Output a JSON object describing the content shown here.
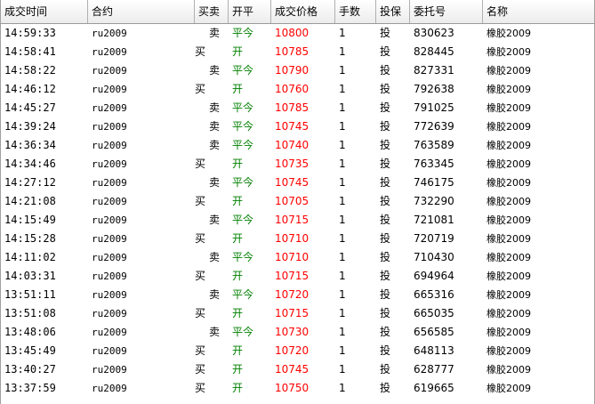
{
  "columns": [
    "成交时间",
    "合约",
    "买卖",
    "开平",
    "成交价格",
    "手数",
    "投保",
    "委托号",
    "名称"
  ],
  "colors": {
    "open_close": "#008000",
    "price": "#ff0000"
  },
  "rows": [
    {
      "time": "14:59:33",
      "contract": "ru2009",
      "side": "卖",
      "oc": "平今",
      "price": "10800",
      "qty": "1",
      "hedge": "投",
      "order": "830623",
      "name": "橡胶2009"
    },
    {
      "time": "14:58:41",
      "contract": "ru2009",
      "side": "买",
      "oc": "开",
      "price": "10785",
      "qty": "1",
      "hedge": "投",
      "order": "828445",
      "name": "橡胶2009"
    },
    {
      "time": "14:58:22",
      "contract": "ru2009",
      "side": "卖",
      "oc": "平今",
      "price": "10790",
      "qty": "1",
      "hedge": "投",
      "order": "827331",
      "name": "橡胶2009"
    },
    {
      "time": "14:46:12",
      "contract": "ru2009",
      "side": "买",
      "oc": "开",
      "price": "10760",
      "qty": "1",
      "hedge": "投",
      "order": "792638",
      "name": "橡胶2009"
    },
    {
      "time": "14:45:27",
      "contract": "ru2009",
      "side": "卖",
      "oc": "平今",
      "price": "10785",
      "qty": "1",
      "hedge": "投",
      "order": "791025",
      "name": "橡胶2009"
    },
    {
      "time": "14:39:24",
      "contract": "ru2009",
      "side": "卖",
      "oc": "平今",
      "price": "10745",
      "qty": "1",
      "hedge": "投",
      "order": "772639",
      "name": "橡胶2009"
    },
    {
      "time": "14:36:34",
      "contract": "ru2009",
      "side": "卖",
      "oc": "平今",
      "price": "10740",
      "qty": "1",
      "hedge": "投",
      "order": "763589",
      "name": "橡胶2009"
    },
    {
      "time": "14:34:46",
      "contract": "ru2009",
      "side": "买",
      "oc": "开",
      "price": "10735",
      "qty": "1",
      "hedge": "投",
      "order": "763345",
      "name": "橡胶2009"
    },
    {
      "time": "14:27:12",
      "contract": "ru2009",
      "side": "卖",
      "oc": "平今",
      "price": "10745",
      "qty": "1",
      "hedge": "投",
      "order": "746175",
      "name": "橡胶2009"
    },
    {
      "time": "14:21:08",
      "contract": "ru2009",
      "side": "买",
      "oc": "开",
      "price": "10705",
      "qty": "1",
      "hedge": "投",
      "order": "732290",
      "name": "橡胶2009"
    },
    {
      "time": "14:15:49",
      "contract": "ru2009",
      "side": "卖",
      "oc": "平今",
      "price": "10715",
      "qty": "1",
      "hedge": "投",
      "order": "721081",
      "name": "橡胶2009"
    },
    {
      "time": "14:15:28",
      "contract": "ru2009",
      "side": "买",
      "oc": "开",
      "price": "10710",
      "qty": "1",
      "hedge": "投",
      "order": "720719",
      "name": "橡胶2009"
    },
    {
      "time": "14:11:02",
      "contract": "ru2009",
      "side": "卖",
      "oc": "平今",
      "price": "10710",
      "qty": "1",
      "hedge": "投",
      "order": "710430",
      "name": "橡胶2009"
    },
    {
      "time": "14:03:31",
      "contract": "ru2009",
      "side": "买",
      "oc": "开",
      "price": "10715",
      "qty": "1",
      "hedge": "投",
      "order": "694964",
      "name": "橡胶2009"
    },
    {
      "time": "13:51:11",
      "contract": "ru2009",
      "side": "卖",
      "oc": "平今",
      "price": "10720",
      "qty": "1",
      "hedge": "投",
      "order": "665316",
      "name": "橡胶2009"
    },
    {
      "time": "13:51:08",
      "contract": "ru2009",
      "side": "买",
      "oc": "开",
      "price": "10715",
      "qty": "1",
      "hedge": "投",
      "order": "665035",
      "name": "橡胶2009"
    },
    {
      "time": "13:48:06",
      "contract": "ru2009",
      "side": "卖",
      "oc": "平今",
      "price": "10730",
      "qty": "1",
      "hedge": "投",
      "order": "656585",
      "name": "橡胶2009"
    },
    {
      "time": "13:45:49",
      "contract": "ru2009",
      "side": "买",
      "oc": "开",
      "price": "10720",
      "qty": "1",
      "hedge": "投",
      "order": "648113",
      "name": "橡胶2009"
    },
    {
      "time": "13:40:27",
      "contract": "ru2009",
      "side": "买",
      "oc": "开",
      "price": "10745",
      "qty": "1",
      "hedge": "投",
      "order": "628777",
      "name": "橡胶2009"
    },
    {
      "time": "13:37:59",
      "contract": "ru2009",
      "side": "买",
      "oc": "开",
      "price": "10750",
      "qty": "1",
      "hedge": "投",
      "order": "619665",
      "name": "橡胶2009"
    }
  ]
}
